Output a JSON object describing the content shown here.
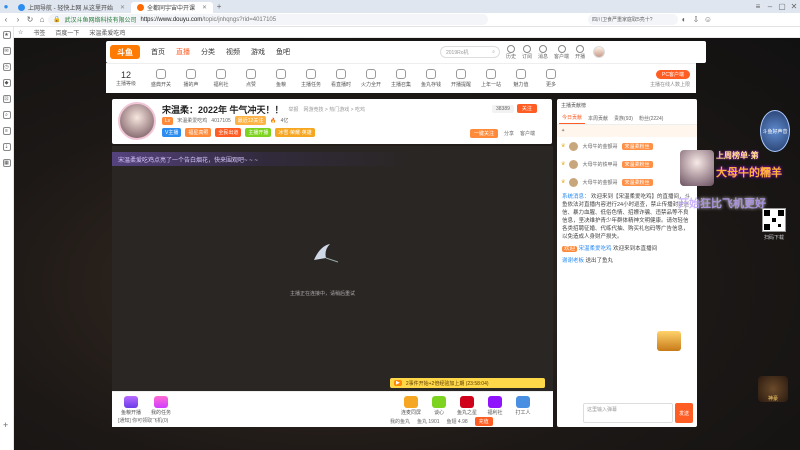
{
  "browser": {
    "tabs": [
      {
        "label": "上网导航 - 轻快上网 从这里开始",
        "active": false
      },
      {
        "label": "全都同宇宙中开课",
        "active": true
      }
    ],
    "secure_label": "武汉斗鱼网络科技有限公司",
    "url_host": "https://www.douyu.com",
    "url_path": "/topic/jnhqngs?rid=4017105",
    "search_hint": "四川卫食严重家庭取5亮十?",
    "bookmarks": [
      "书签",
      "百度一下",
      "宋温柔爱吃鸡"
    ]
  },
  "header": {
    "logo": "斗鱼",
    "nav": [
      "首页",
      "直播",
      "分类",
      "视频",
      "游戏",
      "鱼吧"
    ],
    "active_nav": "直播",
    "search_placeholder": "2019Ro机",
    "icons": [
      "历史",
      "订阅",
      "消息",
      "客户端",
      "开播"
    ]
  },
  "categories": {
    "level_num": "12",
    "level_label": "主播等级",
    "items": [
      "盛典开关",
      "播的声",
      "福利社",
      "点赞",
      "鱼粮",
      "主播任务",
      "看直播时",
      "火力全开",
      "主播召集",
      "鱼丸存钱",
      "开播提醒",
      "上年一站",
      "魅力值",
      "更多"
    ],
    "pc_button": "PC客户端",
    "pc_sub": "主播在线人数上限"
  },
  "anchor": {
    "title": "宋温柔：2022年 牛气冲天！！",
    "tag": "举报",
    "breadcrumb": "网游竞技 > 热门游戏 > 吃鸡",
    "name": "宋温柔爱吃鸡",
    "room_id": "4017105",
    "fans": "最近12关注",
    "hot": "4亿",
    "badges": [
      "V主播",
      "福星高照",
      "全民出道",
      "主播开播",
      "冰雪·荣耀·英雄"
    ],
    "follow_count": "38389",
    "follow_label": "关注",
    "share": "分享",
    "client": "客户端",
    "subscribe": "一键关注"
  },
  "player": {
    "danmu": "宋温柔爱吃鸡点亮了一个告白烟花，快来围观吧~ ~ ~",
    "loading": "主播正在连接中，请稍后重试",
    "notice": "2事件开始+2倍经验加上期 (23:58:04)"
  },
  "gifts": {
    "left": [
      {
        "label": "鱼粮开播"
      },
      {
        "label": "我的任务"
      }
    ],
    "right": [
      {
        "label": "连麦同屏",
        "color": "#f5a623"
      },
      {
        "label": "谈心",
        "color": "#7ed321"
      },
      {
        "label": "鱼丸之星",
        "color": "#d0021b"
      },
      {
        "label": "福利社",
        "color": "#9013fe"
      },
      {
        "label": "打工人",
        "color": "#4a90e2"
      }
    ],
    "fans_bar": "[通知] 你可领取飞机(0)",
    "stats": [
      "我的鱼丸",
      "鱼丸 1901",
      "鱼翅 4.98"
    ],
    "recharge": "充值"
  },
  "chat": {
    "header": "主播贡献榜",
    "tabs": [
      "今日贡献",
      "本周贡献",
      "贵族(93)",
      "粉丝(2224)"
    ],
    "ranks": [
      {
        "name": "大母牛的金额哥",
        "badge": "宋温柔粉丝"
      },
      {
        "name": "大母牛的铁甲哥",
        "badge": "宋温柔粉丝"
      },
      {
        "name": "大母牛的金额哥",
        "badge": "宋温柔粉丝"
      }
    ],
    "messages": [
      {
        "who": "系统消息：",
        "text": "欢迎来到【宋温柔爱吃鸡】的直播间，斗鱼依法对直播内容进行24小时巡查，禁止传播封建迷信、暴力血腥、低俗色情、招嫖诈骗、违禁品等不良信息，坚决维护青少年群体精神文明健康。请勿轻信各类招聘征婚、代练代抽、购买礼包码等广告信息，以免造成人身财产损失。"
      },
      {
        "who": "宋温柔爱吃鸡",
        "tag": "欢迎",
        "text": "欢迎来到本直播间"
      },
      {
        "who": "谢谢老板",
        "text": "送出了鱼丸"
      }
    ],
    "input_placeholder": "这里输入弹幕",
    "send": "发送"
  },
  "overlay": {
    "promo_line1": "上周榜单·第",
    "promo_line2": "大母牛的糯羊",
    "promo_line3": "开始狂比飞机更好",
    "qr_label": "扫码下载",
    "medal": "斗鱼好声音",
    "bottom_badge": "神豪"
  }
}
